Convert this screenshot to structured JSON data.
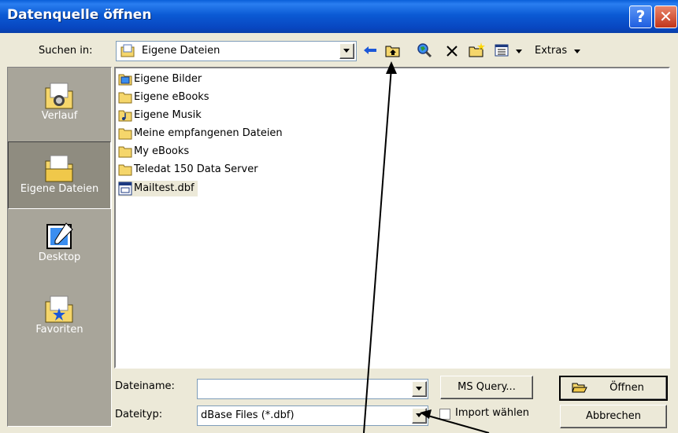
{
  "window": {
    "title": "Datenquelle öffnen"
  },
  "toolbar": {
    "look_in_label": "Suchen in:",
    "look_in_value": "Eigene Dateien",
    "extras_label": "Extras"
  },
  "places": [
    {
      "label": "Verlauf",
      "icon": "history-folder-icon"
    },
    {
      "label": "Eigene Dateien",
      "icon": "my-documents-icon"
    },
    {
      "label": "Desktop",
      "icon": "desktop-icon"
    },
    {
      "label": "Favoriten",
      "icon": "favorites-icon"
    }
  ],
  "files": [
    {
      "name": "Eigene Bilder",
      "icon": "pictures-folder-icon"
    },
    {
      "name": "Eigene eBooks",
      "icon": "folder-icon"
    },
    {
      "name": "Eigene Musik",
      "icon": "music-folder-icon"
    },
    {
      "name": "Meine empfangenen Dateien",
      "icon": "folder-icon"
    },
    {
      "name": "My eBooks",
      "icon": "folder-icon"
    },
    {
      "name": "Teledat 150 Data Server",
      "icon": "folder-icon"
    },
    {
      "name": "Mailtest.dbf",
      "icon": "dbf-file-icon",
      "selected": true
    }
  ],
  "bottom": {
    "filename_label": "Dateiname:",
    "filename_value": "",
    "filetype_label": "Dateityp:",
    "filetype_value": "dBase Files (*.dbf)",
    "ms_query_label": "MS Query...",
    "import_label": "Import wählen",
    "import_checked": false,
    "open_label": "Öffnen",
    "cancel_label": "Abbrechen"
  },
  "colors": {
    "titlebar": "#0a5fd8",
    "dialog_bg": "#ece9d8",
    "places_bg": "#a8a59a",
    "folder_yellow": "#f5d66b"
  }
}
